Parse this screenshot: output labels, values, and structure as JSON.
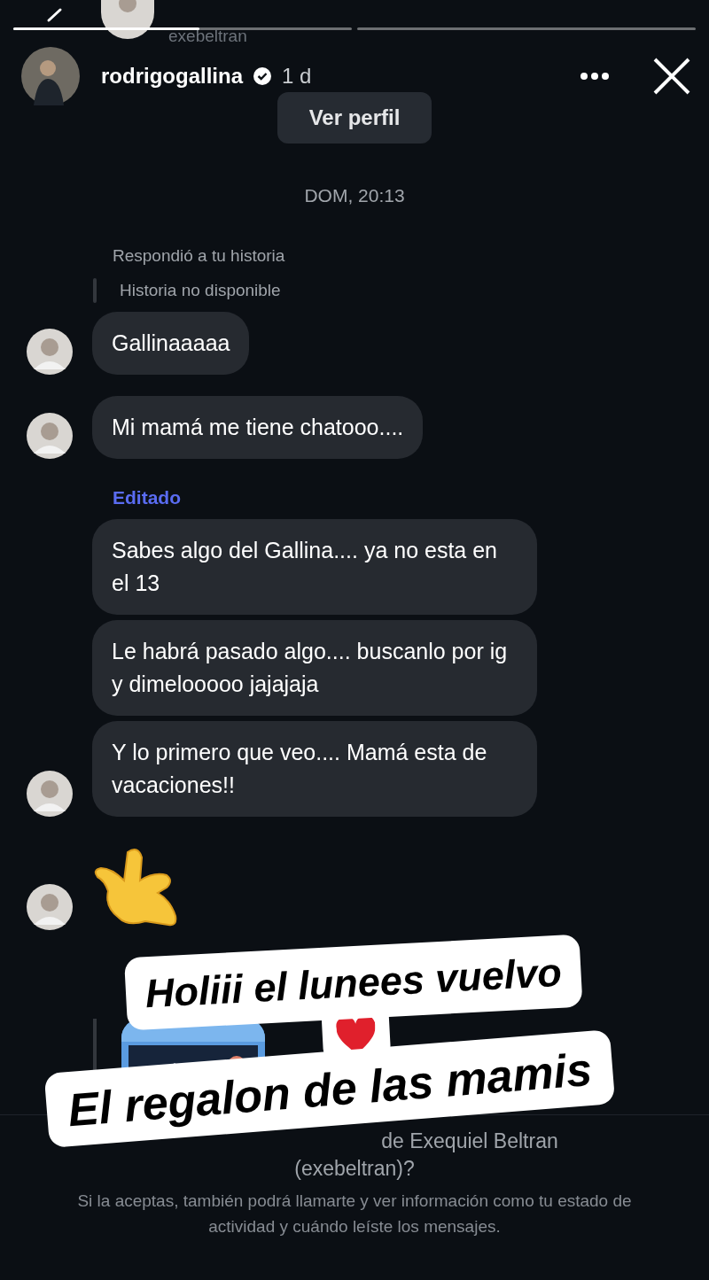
{
  "story": {
    "progress": [
      {
        "kind": "active",
        "level": 0.55
      },
      {
        "kind": "pending"
      }
    ],
    "viewer_handle": "exebeltran",
    "username": "rodrigogallina",
    "verified": true,
    "age": "1 d",
    "profile_button": "Ver perfil"
  },
  "chat": {
    "date": "DOM, 20:13",
    "reply_note": "Respondió a tu historia",
    "reply_quote": "Historia no disponible",
    "messages": [
      {
        "kind": "text",
        "text": "Gallinaaaaa",
        "avatar": true
      },
      {
        "kind": "text",
        "text": "Mi mamá me tiene chatooo....",
        "avatar": true
      },
      {
        "kind": "label",
        "text": "Editado"
      },
      {
        "kind": "text",
        "text": "Sabes algo del Gallina.... ya no esta en el 13",
        "avatar": false
      },
      {
        "kind": "text",
        "text": "Le habrá pasado algo.... buscanlo por ig y dimelooooo jajajaja",
        "avatar": false
      },
      {
        "kind": "text",
        "text": "Y lo primero que veo.... Mamá esta de vacaciones!!",
        "avatar": true
      },
      {
        "kind": "emoji",
        "avatar": true
      },
      {
        "kind": "picture"
      }
    ]
  },
  "request": {
    "title_fragment": "de Exequiel Beltran",
    "handle": "(exebeltran)?",
    "body": "Si la aceptas, también podrá llamarte y ver información como tu estado de actividad y cuándo leíste los mensajes."
  },
  "stickers": [
    {
      "text": "Holiii el lunees vuelvo"
    },
    {
      "text": "El regalon de las mamis"
    }
  ]
}
